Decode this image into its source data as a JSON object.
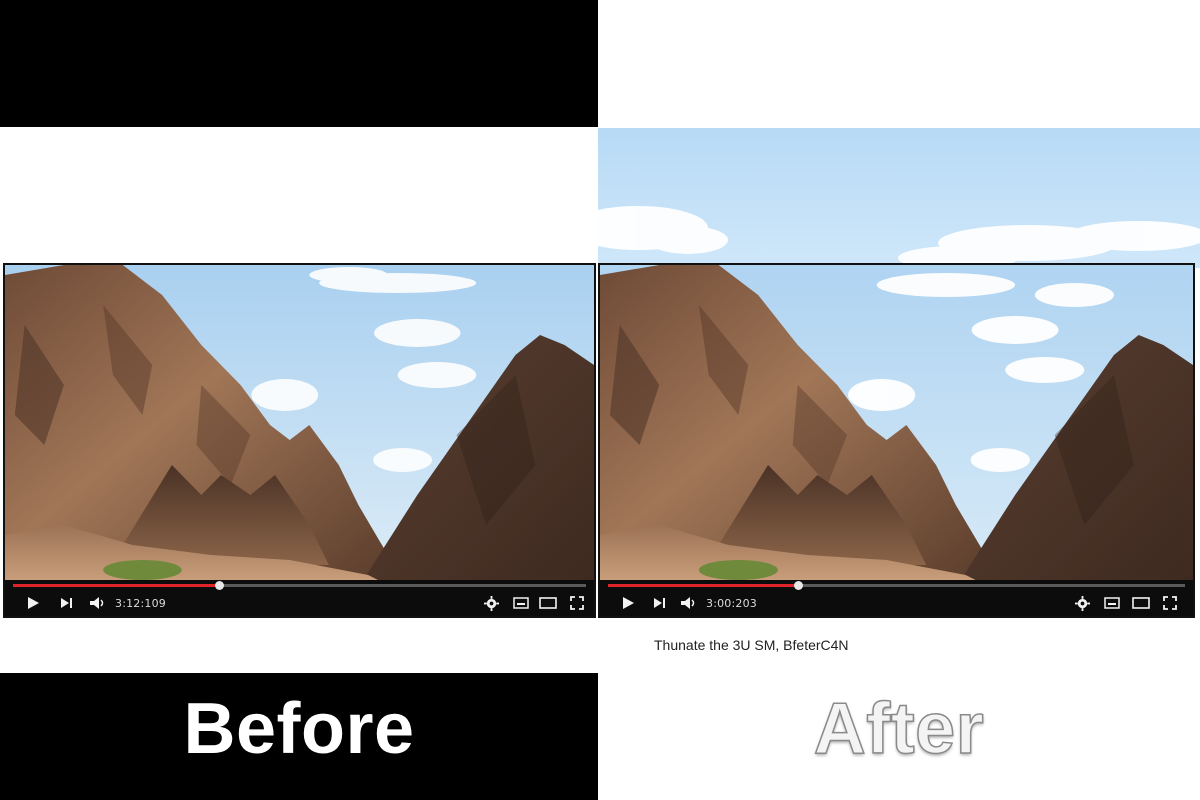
{
  "before": {
    "label": "Before",
    "player": {
      "time": "3:12:109",
      "progress": 0.36
    }
  },
  "after": {
    "label": "After",
    "caption": "Thunate the 3U SM, BfeterC4N",
    "player": {
      "time": "3:00:203",
      "progress": 0.33
    }
  },
  "icons": {
    "play": "play-icon",
    "next": "next-icon",
    "volume": "volume-icon",
    "settings": "gear-icon",
    "subtitles": "subtitles-icon",
    "theater": "theater-mode-icon",
    "fullscreen": "fullscreen-icon"
  },
  "colors": {
    "progress_played": "#e0232b",
    "progress_track": "#5a5a5a",
    "controls_bg": "#0c0c0c",
    "sky": "#b7daf5",
    "rock": "#8a5f44"
  }
}
